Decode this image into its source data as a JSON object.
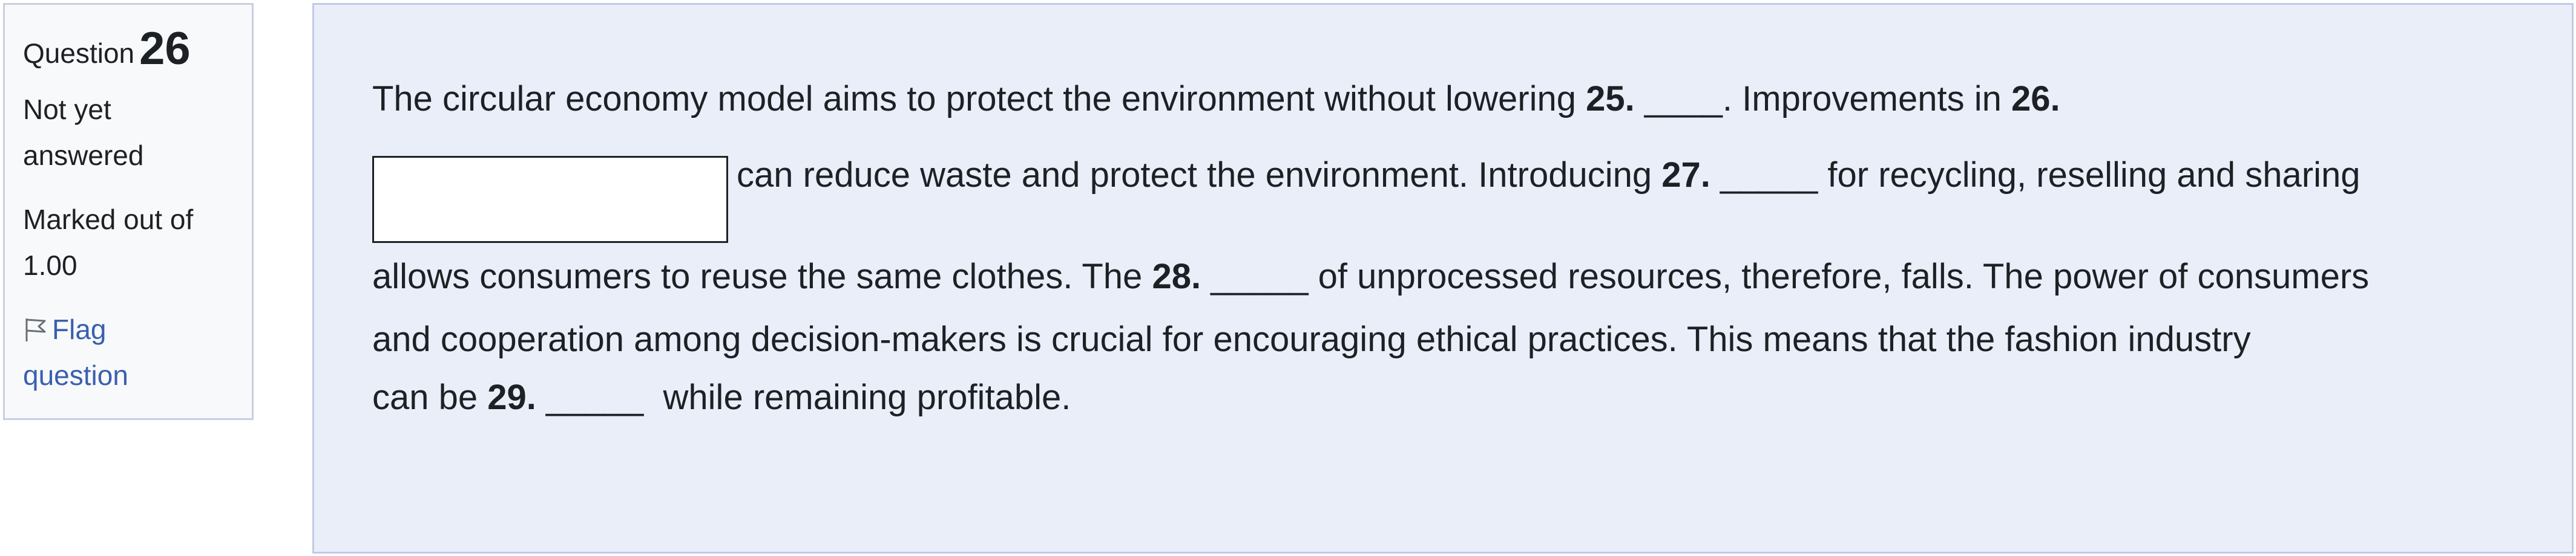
{
  "question_info": {
    "label": "Question",
    "number": "26",
    "state_line1": "Not yet",
    "state_line2": "answered",
    "grade_line1": "Marked out of",
    "grade_line2": "1.00",
    "flag_line1": "Flag",
    "flag_line2": "question",
    "flag_icon": "flag-icon"
  },
  "question_text": {
    "line1_a": "The circular economy model aims to protect the environment without lowering ",
    "line1_b": "25.",
    "line1_c": " ____. Improvements in ",
    "line1_d": "26.",
    "answer_26_value": "",
    "line2_a": "can reduce waste and protect the environment. Introducing ",
    "line2_b": "27.",
    "line2_c": " _____ for recycling, reselling and sharing",
    "line3_a": "allows consumers to reuse the same clothes. The ",
    "line3_b": "28.",
    "line3_c": " _____ of unprocessed resources, therefore, falls. The power of consumers",
    "line4_a": "and cooperation among decision-makers is crucial for encouraging ethical practices. This means that the fashion industry",
    "line5_a": "can be ",
    "line5_b": "29.",
    "line5_c": " _____  while remaining profitable."
  }
}
